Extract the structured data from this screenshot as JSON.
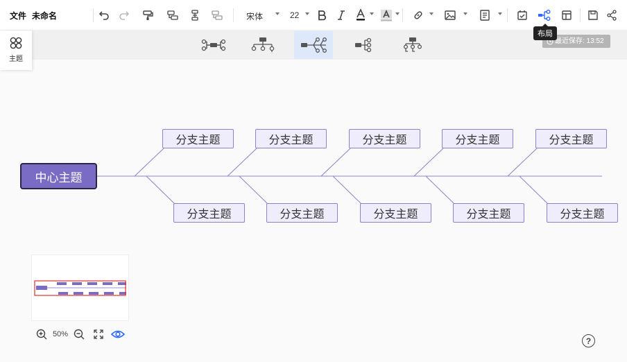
{
  "menu": {
    "file": "文件",
    "doc_title": "未命名"
  },
  "toolbar": {
    "font_family": "宋体",
    "font_size": "22",
    "tooltip": "布局",
    "icons": [
      "undo-icon",
      "redo-icon",
      "format-painter-icon",
      "insert-sibling-icon",
      "insert-child-icon",
      "insert-parent-icon",
      "bold-icon",
      "italic-icon",
      "font-color-icon",
      "highlight-color-icon",
      "link-icon",
      "image-icon",
      "note-icon",
      "task-icon",
      "layout-icon",
      "structure-icon",
      "save-icon",
      "share-icon"
    ],
    "accent": "#2f6bff"
  },
  "status": {
    "last_saved": "最近保存: 13:52"
  },
  "theme_panel": {
    "label": "主题"
  },
  "layout_options": [
    {
      "name": "logic-bilateral",
      "selected": false
    },
    {
      "name": "org-chart-down",
      "selected": false
    },
    {
      "name": "fishbone",
      "selected": true
    },
    {
      "name": "logic-right",
      "selected": false
    },
    {
      "name": "tree-down",
      "selected": false
    }
  ],
  "mindmap": {
    "central": "中心主题",
    "top_branches": [
      "分支主题",
      "分支主题",
      "分支主题",
      "分支主题",
      "分支主题"
    ],
    "bottom_branches": [
      "分支主题",
      "分支主题",
      "分支主题",
      "分支主题",
      "分支主题"
    ],
    "node_color": "#7a6bc4",
    "branch_fill": "#efedfb"
  },
  "minimap": {
    "zoom": "50%"
  },
  "help": {
    "label": "?"
  }
}
